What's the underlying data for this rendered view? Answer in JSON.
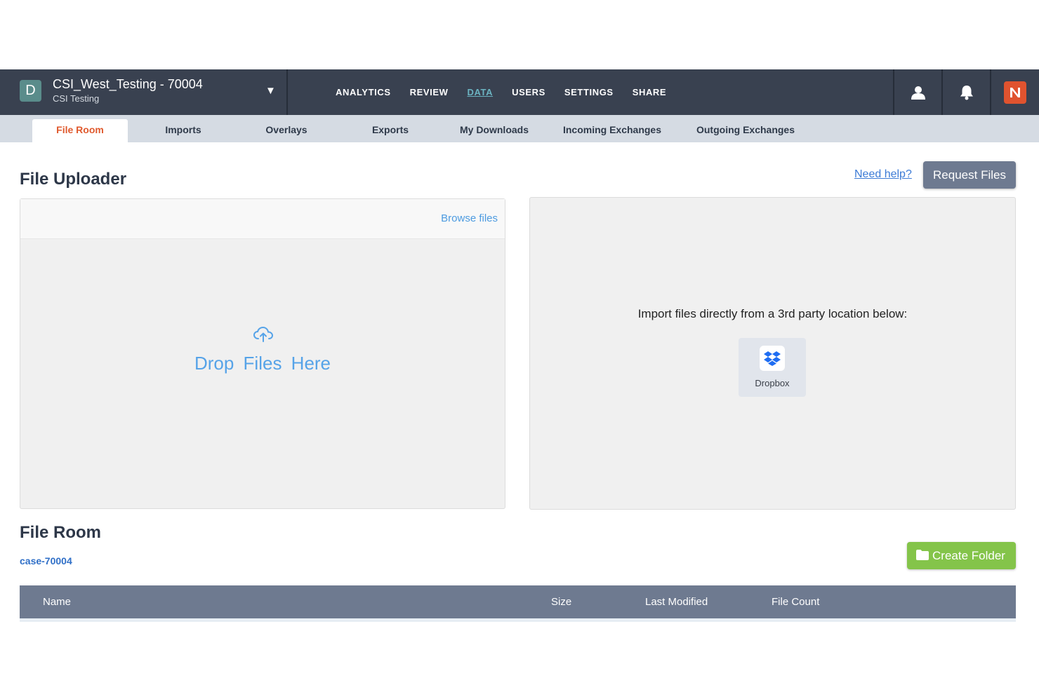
{
  "navbar": {
    "case_initial": "D",
    "case_title": "CSI_West_Testing - 70004",
    "case_subtitle": "CSI Testing",
    "dropdown_caret": "▼",
    "links": [
      "ANALYTICS",
      "REVIEW",
      "DATA",
      "USERS",
      "SETTINGS",
      "SHARE"
    ],
    "active_link": "DATA",
    "icons": [
      "user-icon",
      "bell-icon",
      "brand-logo-icon"
    ],
    "brand_color": "#e0532f",
    "active_link_color": "#6bb3c1"
  },
  "subtabs": {
    "items": [
      "File Room",
      "Imports",
      "Overlays",
      "Exports",
      "My Downloads",
      "Incoming Exchanges",
      "Outgoing Exchanges"
    ],
    "active": "File Room",
    "active_color": "#e05a2e"
  },
  "uploader": {
    "title": "File Uploader",
    "help_link": "Need help?",
    "request_button": "Request Files",
    "browse_link": "Browse files",
    "drop_text": "Drop Files Here",
    "drop_icon": "cloud-upload-icon"
  },
  "import_panel": {
    "text": "Import files directly from a 3rd party location below:",
    "sources": [
      {
        "label": "Dropbox",
        "icon": "dropbox-icon"
      }
    ]
  },
  "file_room": {
    "title": "File Room",
    "breadcrumb": "case-70004",
    "create_button": "Create Folder",
    "create_button_color": "#84c44a",
    "columns": [
      "Name",
      "Size",
      "Last Modified",
      "File Count"
    ],
    "rows": []
  }
}
